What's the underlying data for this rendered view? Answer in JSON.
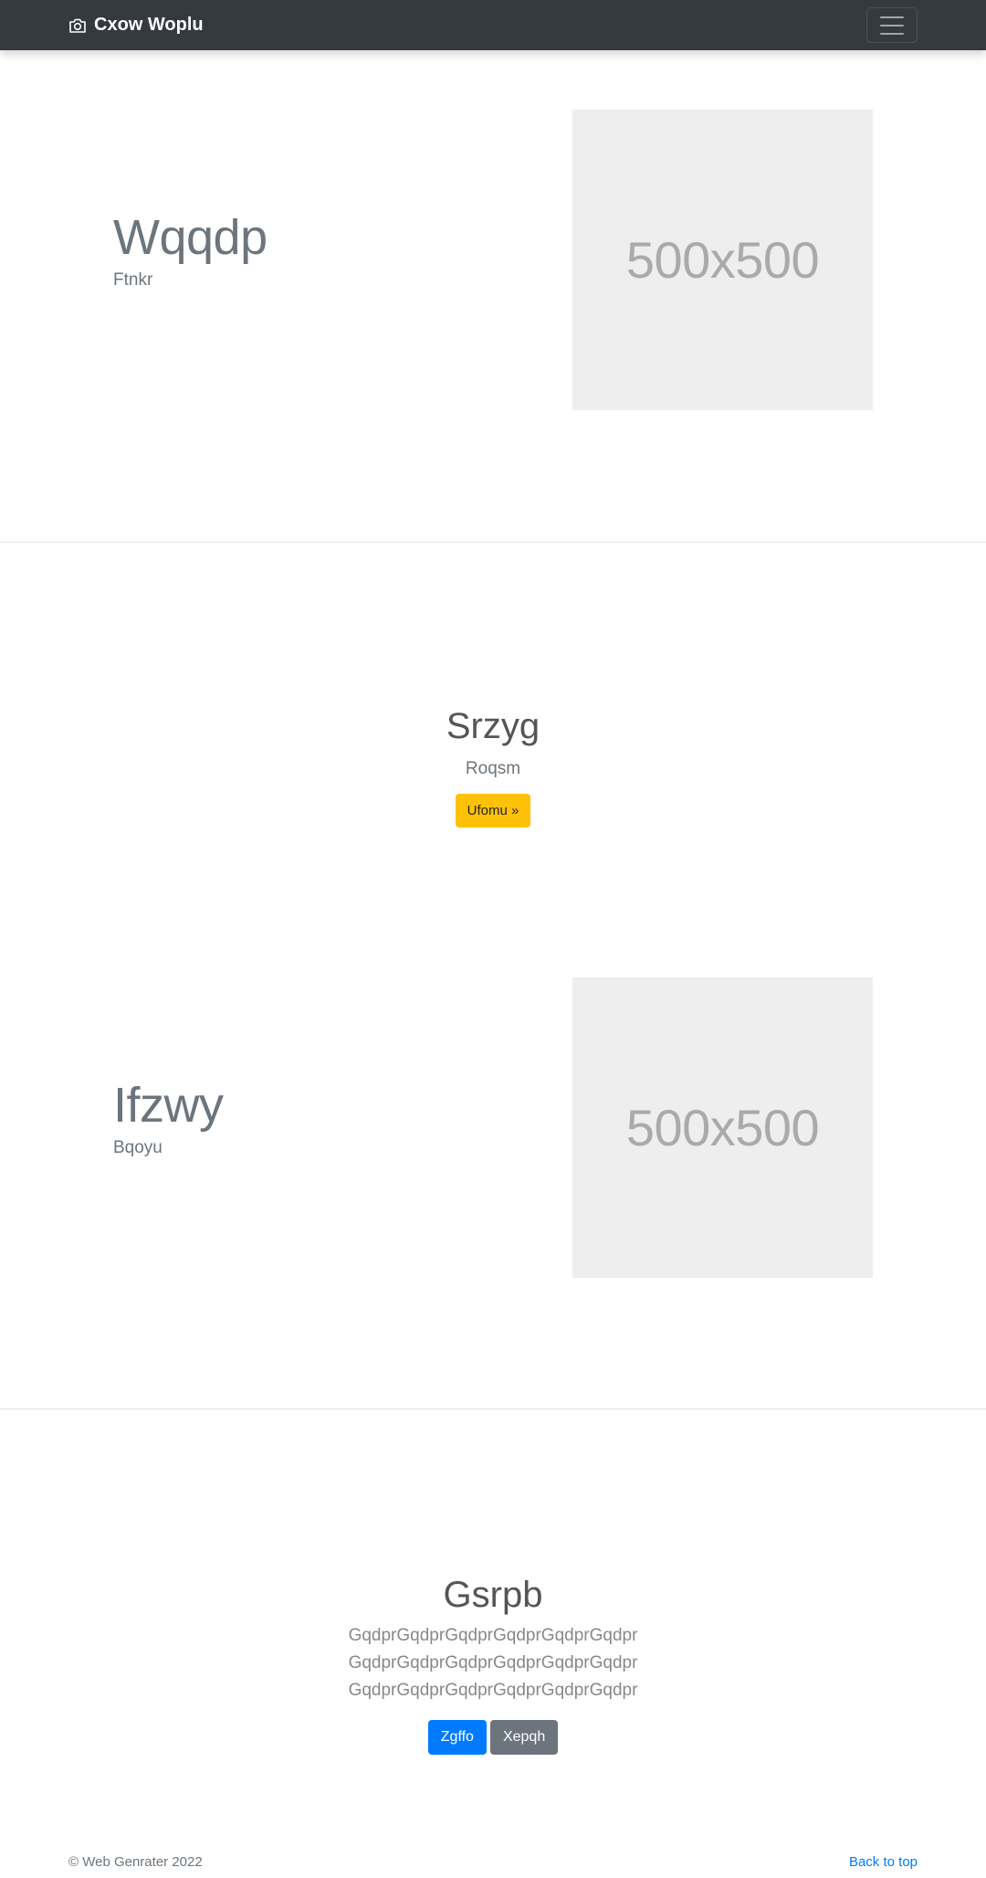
{
  "navbar": {
    "brand": "Cxow Woplu",
    "brand_icon": "camera-icon",
    "toggler_icon": "hamburger-menu-icon",
    "background": "#343a40"
  },
  "feature1": {
    "title": "Wqqdp",
    "subtitle": "Ftnkr",
    "image_label": "500x500"
  },
  "section2": {
    "title": "Srzyg",
    "subtitle": "Roqsm",
    "button_label": "Ufomu »",
    "button_color": "#ffc107"
  },
  "feature2": {
    "title": "Ifzwy",
    "subtitle": "Bqoyu",
    "image_label": "500x500"
  },
  "section4": {
    "title": "Gsrpb",
    "lead": "GqdprGqdprGqdprGqdprGqdprGqdprGqdprGqdprGqdprGqdprGqdprGqdprGqdprGqdprGqdprGqdprGqdprGqdpr",
    "primary_button": "Zgffo",
    "secondary_button": "Xepqh",
    "primary_color": "#007bff",
    "secondary_color": "#6c757d"
  },
  "footer": {
    "copyright": "© Web Genrater 2022",
    "back_to_top": "Back to top"
  }
}
